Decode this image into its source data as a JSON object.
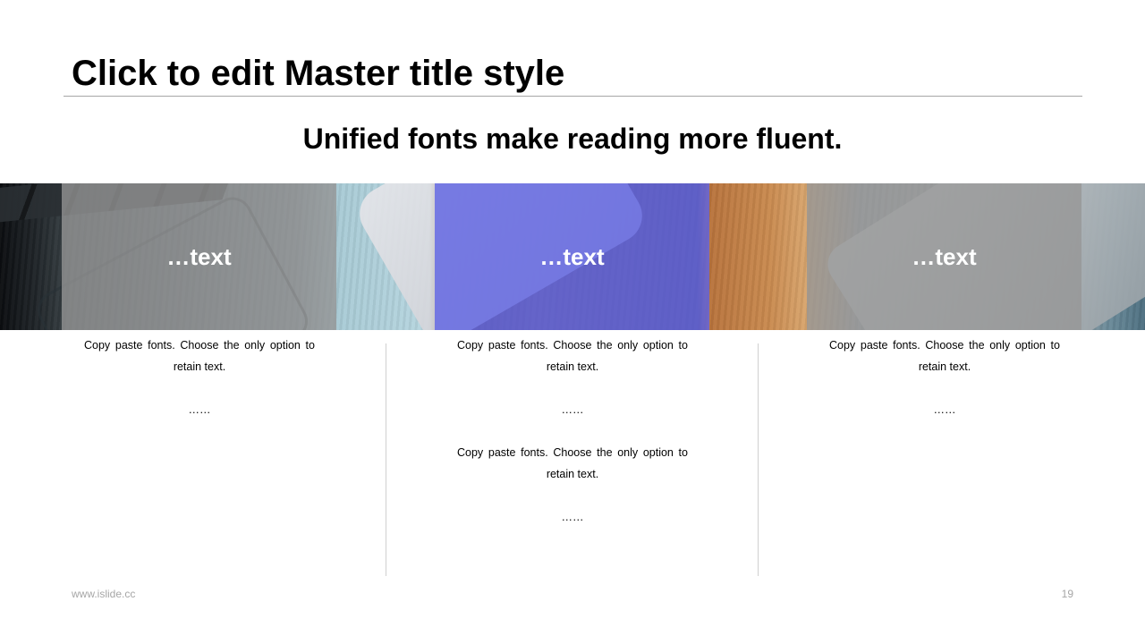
{
  "slide": {
    "title": "Click to edit Master title style",
    "subtitle": "Unified fonts make reading more fluent."
  },
  "banner": {
    "panels": [
      {
        "label": "…text",
        "color": "#969696"
      },
      {
        "label": "…text",
        "color": "#5f64e6"
      },
      {
        "label": "…text",
        "color": "#969696"
      }
    ]
  },
  "columns": [
    {
      "blocks": [
        {
          "text": "Copy paste fonts. Choose the only option to retain text."
        },
        {
          "ellipsis": "……"
        }
      ]
    },
    {
      "blocks": [
        {
          "text": "Copy paste fonts. Choose the only option to retain text."
        },
        {
          "ellipsis": "……"
        },
        {
          "text": "Copy paste fonts. Choose the only option to retain text."
        },
        {
          "ellipsis": "……"
        }
      ]
    },
    {
      "blocks": [
        {
          "text": "Copy paste fonts. Choose the only option to retain text."
        },
        {
          "ellipsis": "……"
        }
      ]
    }
  ],
  "footer": {
    "url": "www.islide.cc",
    "page_number": "19"
  }
}
